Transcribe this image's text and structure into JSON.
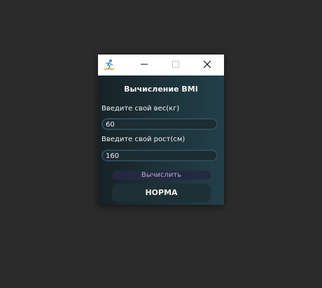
{
  "window": {
    "app_icon": "bmi-app-icon",
    "controls": {
      "minimize_icon": "minimize-icon",
      "maximize_icon": "maximize-icon",
      "close_icon": "close-icon"
    }
  },
  "form": {
    "heading": "Вычисление BMI",
    "weight_label": "Введите свой вес(кг)",
    "weight_value": "60",
    "height_label": "Введите свой рост(см)",
    "height_value": "160",
    "calculate_button": "Вычислить",
    "result": "НОРМА"
  },
  "colors": {
    "desktop": "#2b2b2b",
    "panel_gradient_start": "#162226",
    "panel_gradient_end": "#22404a",
    "button_text": "#b9a6cc"
  }
}
